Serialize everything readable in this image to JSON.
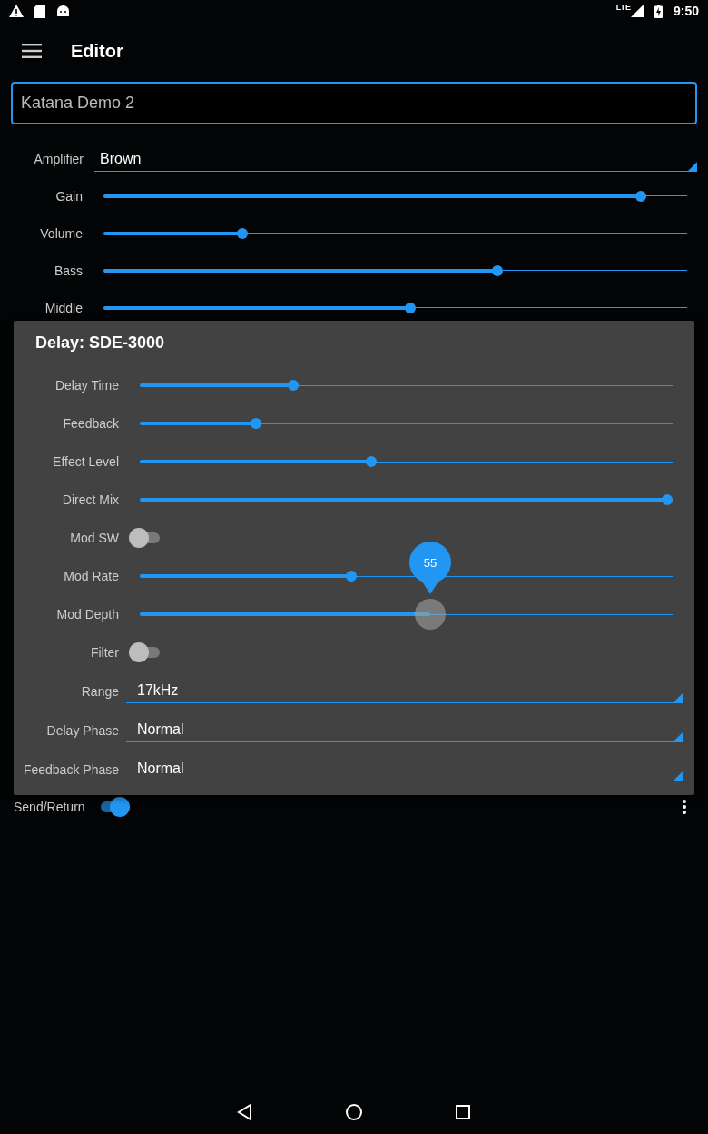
{
  "status_bar": {
    "network": "LTE",
    "time": "9:50"
  },
  "toolbar": {
    "title": "Editor"
  },
  "name_field": {
    "value": "Katana Demo 2"
  },
  "amplifier": {
    "label": "Amplifier",
    "value": "Brown"
  },
  "controls": [
    {
      "label": "Gain",
      "level": 0.928
    },
    {
      "label": "Volume",
      "level": 0.233
    },
    {
      "label": "Bass",
      "level": 0.678
    },
    {
      "label": "Middle",
      "level": 0.526
    }
  ],
  "dialog": {
    "title": "Delay: SDE-3000",
    "rows": [
      {
        "kind": "slider",
        "label": "Delay Time",
        "level": 0.284,
        "pressed": false
      },
      {
        "kind": "slider",
        "label": "Feedback",
        "level": 0.213,
        "pressed": false
      },
      {
        "kind": "slider",
        "label": "Effect Level",
        "level": 0.433,
        "pressed": false
      },
      {
        "kind": "slider",
        "label": "Direct Mix",
        "level": 1.0,
        "pressed": false
      },
      {
        "kind": "switch",
        "label": "Mod SW",
        "on": false
      },
      {
        "kind": "slider",
        "label": "Mod Rate",
        "level": 0.395,
        "pressed": false
      },
      {
        "kind": "slider",
        "label": "Mod Depth",
        "level": 0.545,
        "pressed": true,
        "bubble": "55"
      },
      {
        "kind": "switch",
        "label": "Filter",
        "on": false
      },
      {
        "kind": "dropdown",
        "label": "Range",
        "value": "17kHz"
      },
      {
        "kind": "dropdown",
        "label": "Delay Phase",
        "value": "Normal"
      },
      {
        "kind": "dropdown",
        "label": "Feedback Phase",
        "value": "Normal"
      }
    ]
  },
  "send_return": {
    "label": "Send/Return",
    "on": true
  }
}
